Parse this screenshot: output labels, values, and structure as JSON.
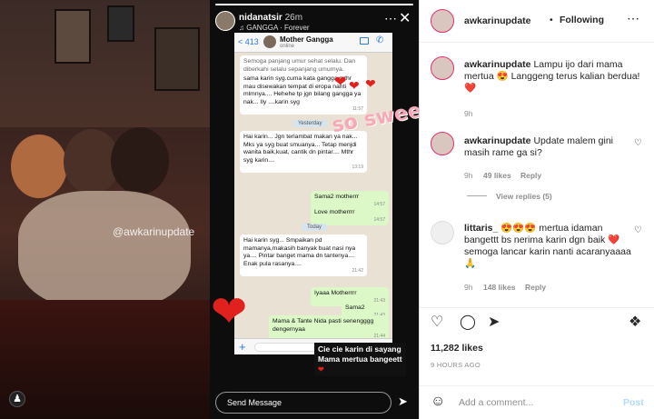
{
  "photo": {
    "watermark": "@awkarinupdate",
    "user_icon": "user-tag-icon"
  },
  "story": {
    "username": "nidanatsir",
    "time": "26m",
    "music": "GANGGA · Forever",
    "more_icon": "more-icon",
    "close_icon": "close-icon",
    "chat": {
      "back": "< 413",
      "contact": "Mother Gangga",
      "status": "online",
      "messages": [
        {
          "dir": "in",
          "text": "Semoga panjang umur sehat selalu. Dan diberkahi selalu sepanjang umurnya.",
          "time": ""
        },
        {
          "dir": "in",
          "text": "sama karin syg.cuma kata gangga mthr mau disewakan tempat di eropa nanti mlmnya.... Hehehe tp jgn bilang gangga ya nak... Ily ....karin syg",
          "time": "11:57"
        },
        {
          "dir": "in",
          "text": "Hai karin... Jgn terlambat makan ya nak... Mks ya syg buat smuanya... Tetap menjdi wanita baik,kuat, cantik dn pintar.... Mthr syg karin....",
          "time": "13:19"
        },
        {
          "dir": "out",
          "text": "Sama2 motherrr",
          "time": "14:57"
        },
        {
          "dir": "out",
          "text": "Love motherrrr",
          "time": "14:57"
        },
        {
          "dir": "in",
          "text": "Hai karin syg... Smpaikan pd mamanya,makasih banyak buat nasi nya ya.... Pintar banget mama dn tantenya.... Enak pula rasanya....",
          "time": "21:42"
        },
        {
          "dir": "out",
          "text": "Iyaaa Motherrrr",
          "time": "21:43"
        },
        {
          "dir": "out",
          "text": "Sama2",
          "time": "21:43"
        },
        {
          "dir": "out",
          "text": "Mama & Tante Nida pasti senengggg dengernyaa",
          "time": "21:44"
        }
      ],
      "day_labels": [
        "Yesterday",
        "Today"
      ]
    },
    "sticker": "so sweet!",
    "caption_line1": "Cie cie karin di sayang",
    "caption_line2": "Mama mertua bangeett",
    "send_placeholder": "Send Message"
  },
  "post": {
    "username": "awkarinupdate",
    "dot": "•",
    "follow_state": "Following",
    "more_icon": "more-icon",
    "caption_user": "awkarinupdate",
    "caption_text": "Lampu ijo dari mama mertua 😍 Langgeng terus kalian berdua! ❤️",
    "caption_time": "9h",
    "comments": [
      {
        "user": "awkarinupdate",
        "text": "Update malem gini masih rame ga si?",
        "time": "9h",
        "likes": "49 likes",
        "reply": "Reply",
        "view_replies": "View replies (5)"
      },
      {
        "user": "littaris_",
        "text": "😍😍😍 mertua idaman bangettt bs nerima karin dgn baik ❤️ semoga lancar karin nanti acaranyaaaa🙏",
        "time": "9h",
        "likes": "148 likes",
        "reply": "Reply"
      }
    ],
    "likes_count": "11,282 likes",
    "posted_time": "9 HOURS AGO",
    "add_comment_placeholder": "Add a comment...",
    "post_button": "Post"
  }
}
